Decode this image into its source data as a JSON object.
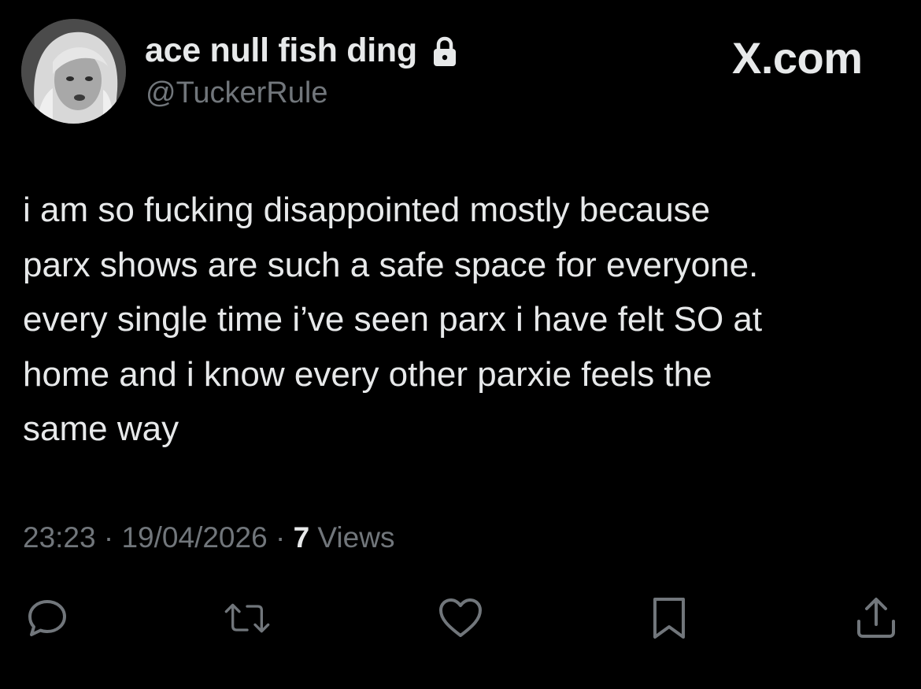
{
  "tweet": {
    "author": {
      "display_name": "ace null fish ding",
      "handle": "@TuckerRule",
      "protected": true
    },
    "brand": "X.com",
    "text": "i am so fucking disappointed mostly because\nparx shows are such a safe space for everyone.\nevery single time i’ve seen parx i have felt SO at\nhome and i know every other parxie feels the\nsame way",
    "meta": {
      "time": "23:23",
      "separator": " · ",
      "date": "19/04/2026",
      "views_count": "7",
      "views_label": " Views"
    },
    "actions": [
      {
        "name": "reply",
        "icon": "reply-icon"
      },
      {
        "name": "repost",
        "icon": "repost-icon"
      },
      {
        "name": "like",
        "icon": "heart-icon"
      },
      {
        "name": "bookmark",
        "icon": "bookmark-icon"
      },
      {
        "name": "share",
        "icon": "share-icon"
      }
    ]
  },
  "colors": {
    "background": "#000000",
    "primary_text": "#e7e9ea",
    "secondary_text": "#71767b",
    "icon_gray": "#71767b"
  }
}
